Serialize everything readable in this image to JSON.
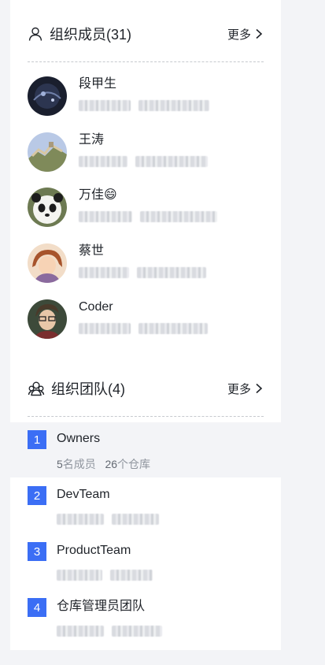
{
  "members_section": {
    "title": "组织成员(31)",
    "more_label": "更多",
    "members": [
      {
        "name": "段甲生"
      },
      {
        "name": "王涛"
      },
      {
        "name": "万佳😄"
      },
      {
        "name": "蔡世"
      },
      {
        "name": "Coder"
      }
    ]
  },
  "teams_section": {
    "title": "组织团队(4)",
    "more_label": "更多",
    "teams": [
      {
        "index": "1",
        "name": "Owners",
        "member_count": "5",
        "member_unit": "名成员",
        "repo_count": "26",
        "repo_unit": "个仓库"
      },
      {
        "index": "2",
        "name": "DevTeam"
      },
      {
        "index": "3",
        "name": "ProductTeam"
      },
      {
        "index": "4",
        "name": "仓库管理员团队"
      }
    ]
  },
  "colors": {
    "accent": "#3b6ef5",
    "active_row": "#f3f4f7",
    "page_bg": "#f3f4f7"
  },
  "icons": [
    "user-icon",
    "group-icon",
    "chevron-right-icon"
  ]
}
